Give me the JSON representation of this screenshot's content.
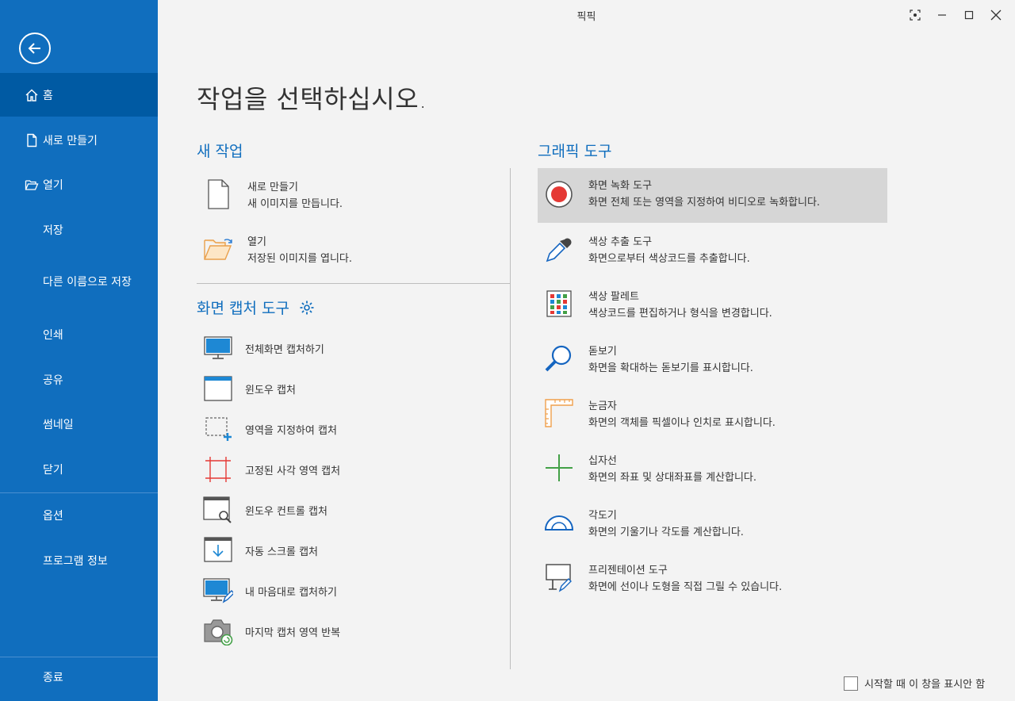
{
  "window": {
    "title": "픽픽"
  },
  "sidebar": {
    "home": "홈",
    "new": "새로 만들기",
    "open": "열기",
    "save": "저장",
    "save_as": "다른 이름으로 저장",
    "print": "인쇄",
    "share": "공유",
    "thumbnail": "썸네일",
    "close": "닫기",
    "options": "옵션",
    "about": "프로그램 정보",
    "exit": "종료"
  },
  "main": {
    "heading": "작업을 선택하십시오.",
    "new_task": {
      "title": "새 작업",
      "items": [
        {
          "name": "새로 만들기",
          "desc": "새 이미지를 만듭니다."
        },
        {
          "name": "열기",
          "desc": "저장된 이미지를 엽니다."
        }
      ]
    },
    "capture": {
      "title": "화면 캡처 도구",
      "items": [
        "전체화면 캡처하기",
        "윈도우 캡처",
        "영역을 지정하여 캡처",
        "고정된 사각 영역 캡처",
        "윈도우 컨트롤 캡처",
        "자동 스크롤 캡처",
        "내 마음대로 캡처하기",
        "마지막 캡처 영역 반복"
      ]
    },
    "graphic": {
      "title": "그래픽 도구",
      "items": [
        {
          "name": "화면 녹화 도구",
          "desc": "화면 전체 또는 영역을 지정하여 비디오로 녹화합니다."
        },
        {
          "name": "색상 추출 도구",
          "desc": "화면으로부터 색상코드를 추출합니다."
        },
        {
          "name": "색상 팔레트",
          "desc": "색상코드를 편집하거나 형식을 변경합니다."
        },
        {
          "name": "돋보기",
          "desc": "화면을 확대하는 돋보기를 표시합니다."
        },
        {
          "name": "눈금자",
          "desc": "화면의 객체를 픽셀이나 인치로 표시합니다."
        },
        {
          "name": "십자선",
          "desc": "화면의 좌표 및 상대좌표를 계산합니다."
        },
        {
          "name": "각도기",
          "desc": "화면의 기울기나 각도를 계산합니다."
        },
        {
          "name": "프리젠테이션 도구",
          "desc": "화면에 선이나 도형을 직접 그릴 수 있습니다."
        }
      ]
    }
  },
  "footer": {
    "startup_label": "시작할 때 이 창을 표시안 함"
  },
  "colors": {
    "sidebar": "#106ebe",
    "sidebar_active": "#005aa3",
    "accent": "#106ebe"
  }
}
